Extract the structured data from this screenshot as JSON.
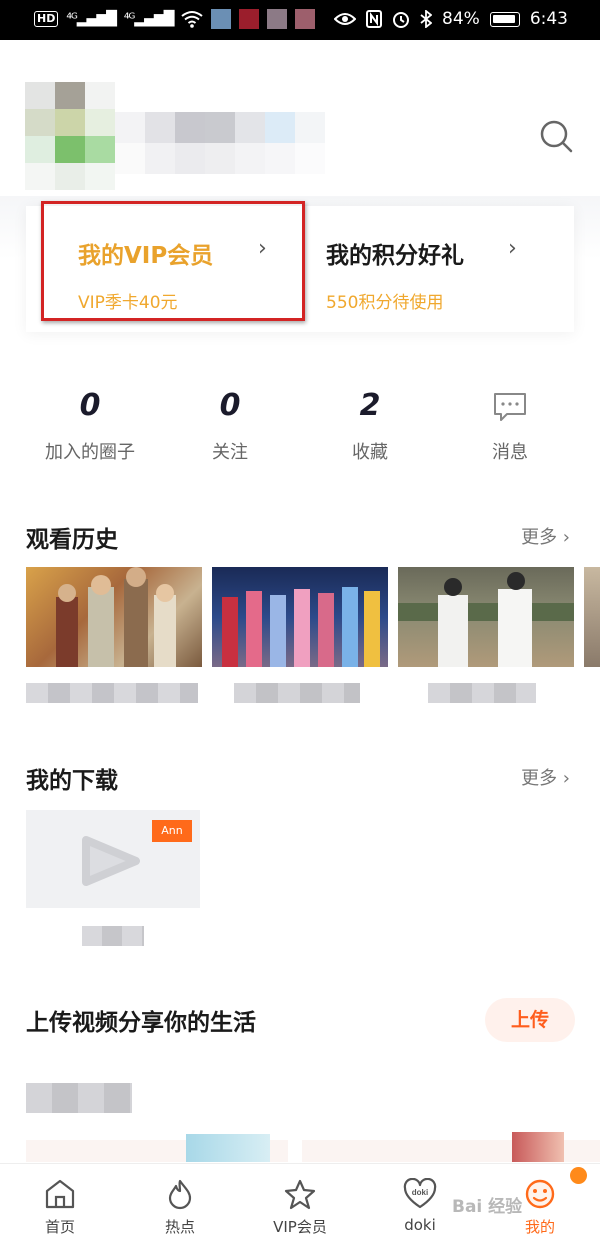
{
  "status_bar": {
    "hd_label": "HD",
    "signal_1": "⁴ᴳ▂▄▆█",
    "signal_2": "⁴ᴳ▂▄▆█",
    "wifi_icon": "wifi-icon",
    "battery_percent": "84%",
    "time": "6:43"
  },
  "profile": {
    "search_icon": "search-icon"
  },
  "cards": {
    "vip": {
      "title": "我的VIP会员",
      "subtitle": "VIP季卡40元",
      "chevron": "›"
    },
    "points": {
      "title": "我的积分好礼",
      "subtitle": "550积分待使用",
      "chevron": "›"
    }
  },
  "stats": [
    {
      "value": "0",
      "label": "加入的圈子"
    },
    {
      "value": "0",
      "label": "关注"
    },
    {
      "value": "2",
      "label": "收藏"
    },
    {
      "value": "",
      "label": "消息",
      "icon": "message-icon"
    }
  ],
  "history": {
    "title": "观看历史",
    "more": "更多 ›"
  },
  "downloads": {
    "title": "我的下载",
    "more": "更多 ›",
    "badge": "Ann"
  },
  "upload": {
    "title": "上传视频分享你的生活",
    "button": "上传"
  },
  "tabbar": {
    "items": [
      {
        "label": "首页",
        "icon": "home-icon"
      },
      {
        "label": "热点",
        "icon": "flame-icon"
      },
      {
        "label": "VIP会员",
        "icon": "star-icon"
      },
      {
        "label": "doki",
        "icon": "doki-heart-icon"
      },
      {
        "label": "我的",
        "icon": "face-icon"
      }
    ]
  },
  "watermark": "Bai 经验",
  "colors": {
    "accent": "#ff6a1a",
    "vip_gold": "#e9a22c",
    "highlight_red": "#d32424"
  }
}
